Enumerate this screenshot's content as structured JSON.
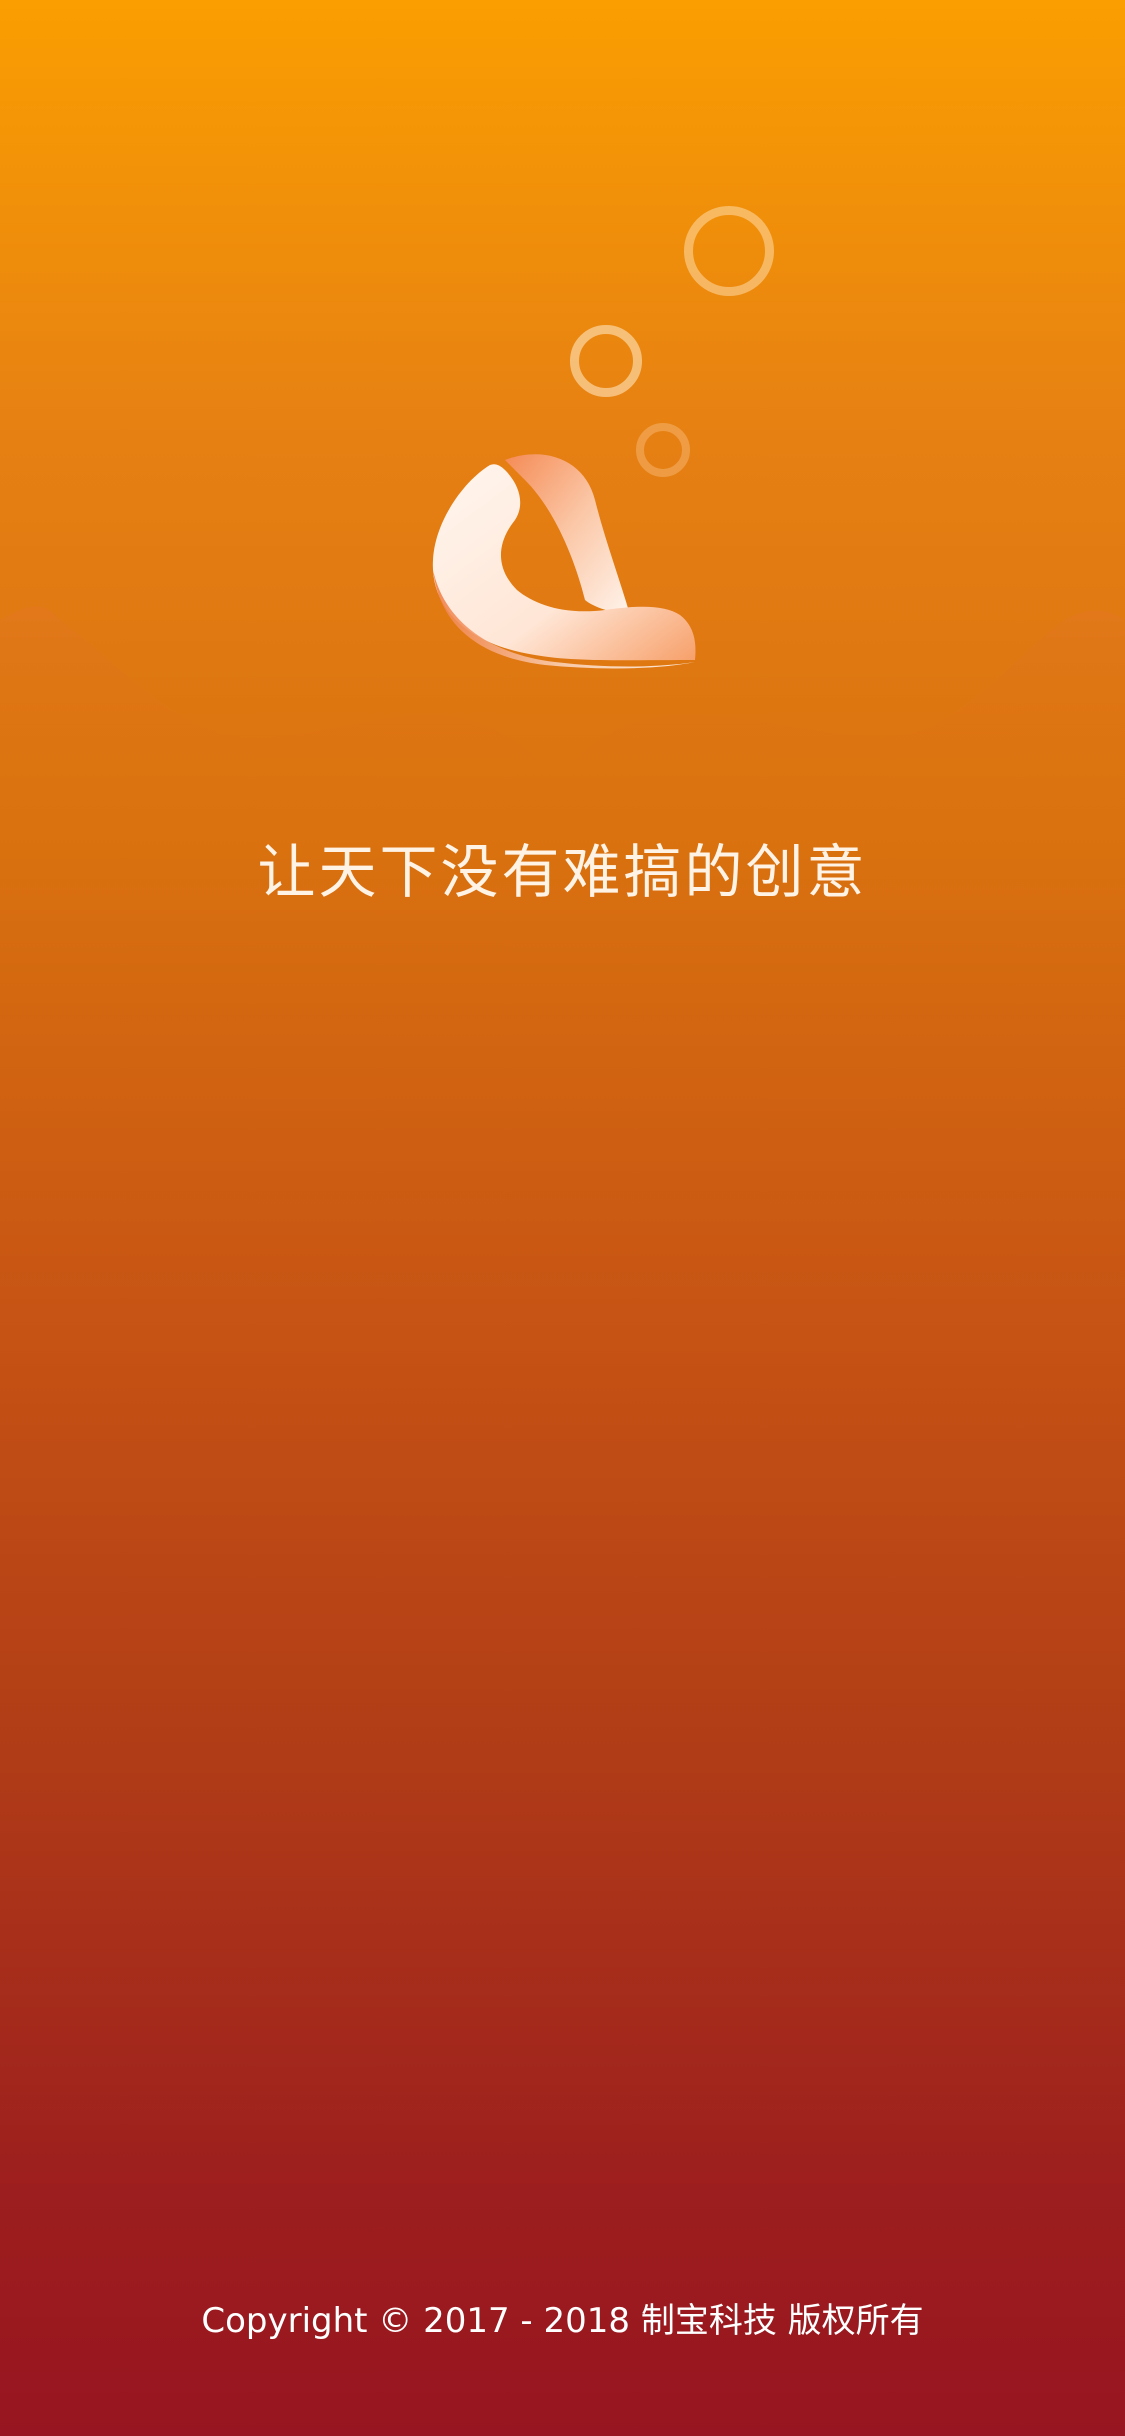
{
  "splash": {
    "slogan": "让天下没有难搞的创意",
    "copyright": "Copyright © 2017 - 2018 制宝科技 版权所有",
    "logo_icon": "sailboat-logo-icon",
    "decorations": [
      "bubble-large",
      "bubble-medium",
      "bubble-small",
      "wave-hills"
    ]
  },
  "colors": {
    "background_top": "#fa9e01",
    "background_bottom": "#971520",
    "text": "#ffffff",
    "logo_light": "#fff4ec",
    "logo_accent": "#f08850"
  }
}
